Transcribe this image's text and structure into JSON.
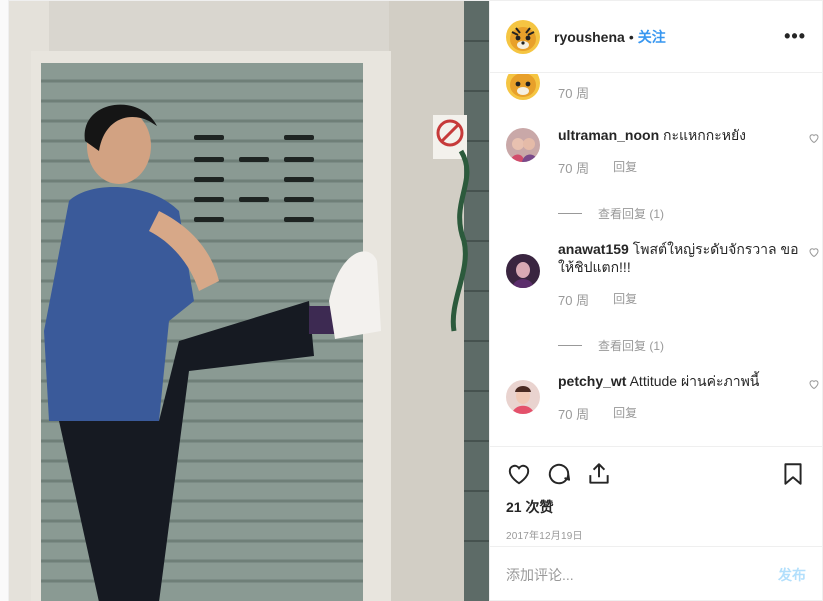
{
  "header": {
    "username": "ryoushena",
    "separator": "•",
    "follow_label": "关注",
    "more_icon": "more-horizontal-icon"
  },
  "caption": {
    "time": "70 周"
  },
  "comments": [
    {
      "username": "ultraman_noon",
      "text": "กะแหกกะหยัง",
      "time": "70 周",
      "reply_label": "回复",
      "view_replies": "查看回复 (1)"
    },
    {
      "username": "anawat159",
      "text": "โพสต์ใหญ่ระดับจักรวาล ขอให้ชิปแตก!!!",
      "time": "70 周",
      "reply_label": "回复",
      "view_replies": "查看回复 (1)"
    },
    {
      "username": "petchy_wt",
      "text": "Attitude ผ่านค่ะภาพนี้",
      "time": "70 周",
      "reply_label": "回复"
    }
  ],
  "actions": {
    "icons": [
      "heart-icon",
      "comment-icon",
      "share-icon",
      "bookmark-icon"
    ],
    "likes": "21 次赞",
    "date": "2017年12月19日"
  },
  "add_comment": {
    "placeholder": "添加评论...",
    "post_label": "发布"
  },
  "colors": {
    "link": "#3897f0",
    "post_disabled": "#b2dffc",
    "muted": "#999999",
    "text": "#262626"
  }
}
